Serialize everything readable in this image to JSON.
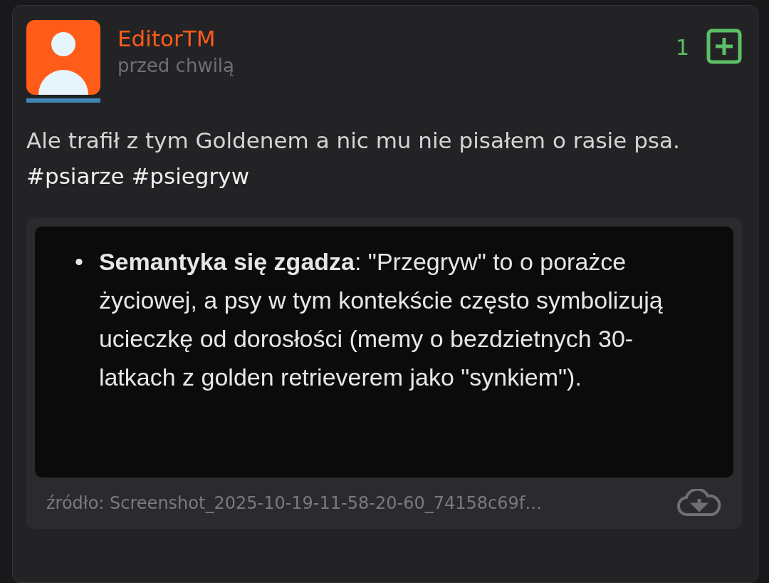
{
  "author": {
    "name": "EditorTM",
    "time": "przed chwilą"
  },
  "vote": {
    "count": "1"
  },
  "post": {
    "text": "Ale trafił z tym Goldenem a nic mu nie pisałem o rasie psa.",
    "tags": [
      "#psiarze",
      "#psiegryw"
    ]
  },
  "attachment": {
    "bullet": "•",
    "text": "**Semantyka się zgadza**: \"Przegryw\" to o porażce życiowej, a psy w tym kontekście często symbolizują ucieczkę od dorosłości (memy o bezdzietnych 30-latkach z golden retrieverem jako \"synkiem\").",
    "source": "źródło: Screenshot_2025-10-19-11-58-20-60_74158c69f…"
  }
}
